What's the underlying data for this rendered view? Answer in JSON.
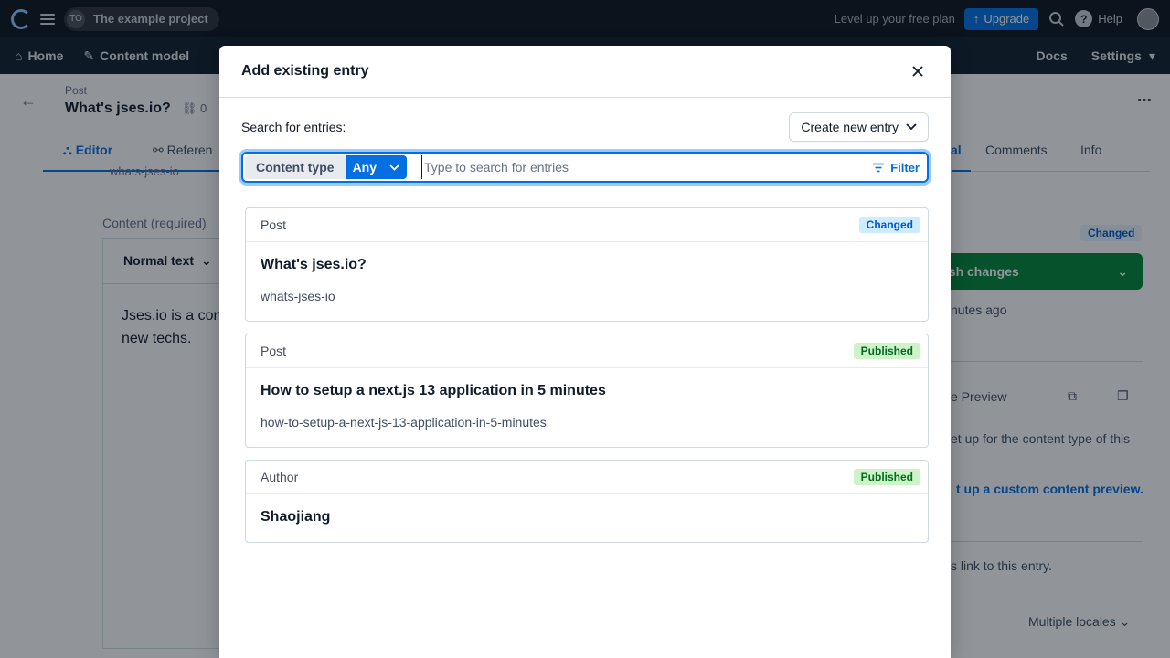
{
  "topbar": {
    "space_initials": "TO",
    "space_name": "The example project",
    "level_up_text": "Level up your free plan",
    "upgrade_label": "Upgrade",
    "help_label": "Help"
  },
  "nav": {
    "home": "Home",
    "content_model": "Content model",
    "docs": "Docs",
    "settings": "Settings"
  },
  "entry": {
    "type": "Post",
    "title": "What's jses.io?",
    "ref_count": "0",
    "tabs": {
      "editor": "Editor",
      "references": "Referen",
      "comments": "Comments",
      "info": "Info",
      "partial": "al"
    },
    "slug_peek": "whats-jses-io",
    "content_label": "Content (required)",
    "rte_format": "Normal text",
    "rte_text_line1": "Jses.io is a con",
    "rte_text_line2": "new techs.",
    "status": "Changed",
    "publish_label": "lish changes",
    "last_saved": "nutes ago",
    "preview_label": "e Preview",
    "preview_note": "et up for the content type of this",
    "preview_link": "t up a custom content preview.",
    "links_note": "s link to this entry.",
    "locales": "Multiple locales"
  },
  "modal": {
    "title": "Add existing entry",
    "search_label": "Search for entries:",
    "create_label": "Create new entry",
    "content_type_label": "Content type",
    "content_type_value": "Any",
    "search_placeholder": "Type to search for entries",
    "filter_label": "Filter",
    "results": [
      {
        "type": "Post",
        "status": "Changed",
        "title": "What's jses.io?",
        "slug": "whats-jses-io"
      },
      {
        "type": "Post",
        "status": "Published",
        "title": "How to setup a next.js 13 application in 5 minutes",
        "slug": "how-to-setup-a-next-js-13-application-in-5-minutes"
      },
      {
        "type": "Author",
        "status": "Published",
        "title": "Shaojiang"
      }
    ]
  },
  "colors": {
    "primary": "#036fe3",
    "changed_bg": "#ceecff",
    "published_bg": "#cdf3c6",
    "publish_green": "#008539"
  }
}
